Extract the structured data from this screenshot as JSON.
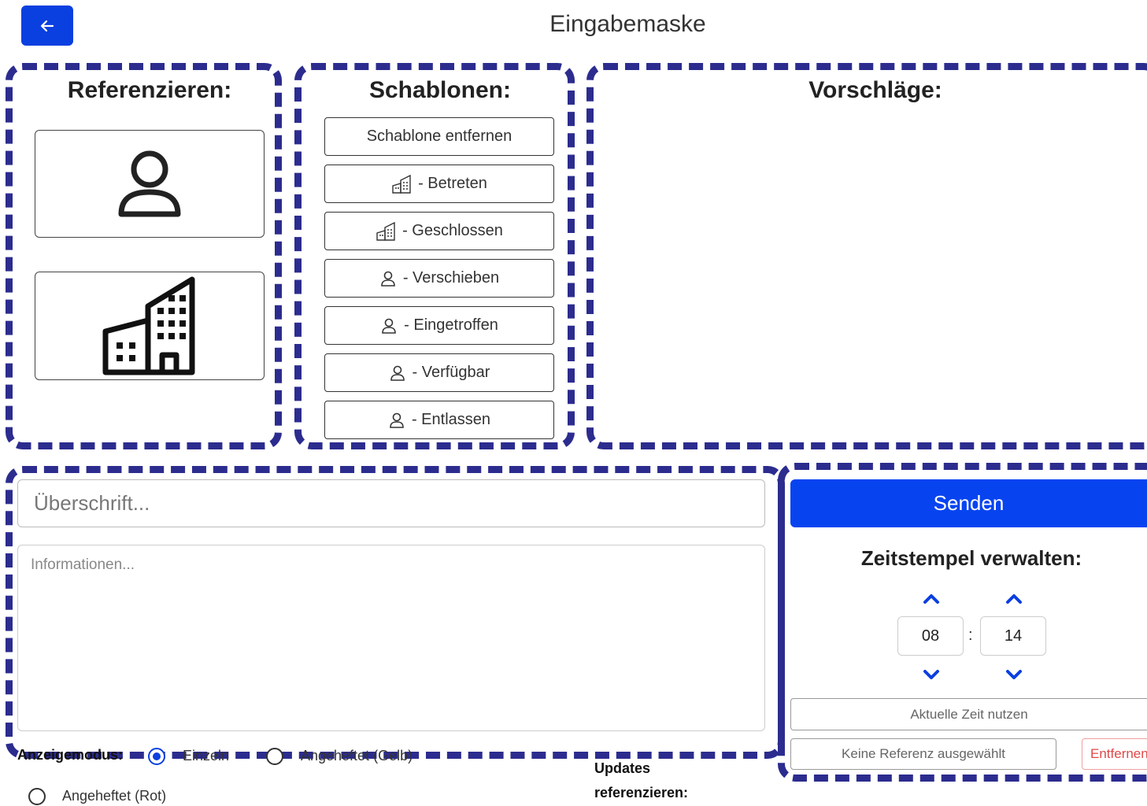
{
  "header": {
    "title": "Eingabemaske",
    "back_icon": "arrow-left-icon"
  },
  "colors": {
    "accent": "#0744f0",
    "panel_border": "#2c2c8f"
  },
  "referenzieren": {
    "heading": "Referenzieren:",
    "cards": [
      {
        "icon": "person-icon"
      },
      {
        "icon": "building-icon"
      }
    ]
  },
  "schablonen": {
    "heading": "Schablonen:",
    "items": [
      {
        "label": "Schablone entfernen",
        "icon": ""
      },
      {
        "label": "- Betreten",
        "icon": "building-icon"
      },
      {
        "label": "- Geschlossen",
        "icon": "building-icon"
      },
      {
        "label": "- Verschieben",
        "icon": "person-icon"
      },
      {
        "label": "- Eingetroffen",
        "icon": "person-icon"
      },
      {
        "label": "- Verfügbar",
        "icon": "person-icon"
      },
      {
        "label": "- Entlassen",
        "icon": "person-icon"
      }
    ]
  },
  "vorschlaege": {
    "heading": "Vorschläge:"
  },
  "form": {
    "title_placeholder": "Überschrift...",
    "info_placeholder": "Informationen..."
  },
  "send": {
    "label": "Senden",
    "timestamp_heading": "Zeitstempel verwalten:",
    "hours": "08",
    "separator": ":",
    "minutes": "14",
    "current_time_label": "Aktuelle Zeit nutzen",
    "reference_label": "Keine Referenz ausgewählt",
    "remove_label": "Entfernen"
  },
  "display_mode": {
    "label": "Anzeigemodus:",
    "options": [
      "Einzeln",
      "Angeheftet (Gelb)",
      "Angeheftet (Rot)"
    ],
    "selected": "Einzeln"
  },
  "updates": {
    "label_line1": "Updates",
    "label_line2": "referenzieren:"
  }
}
